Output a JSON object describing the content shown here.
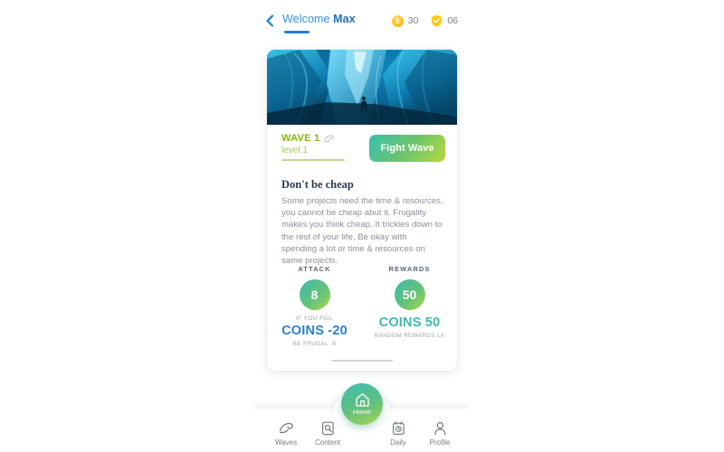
{
  "header": {
    "back_icon": "chevron-left-icon",
    "welcome_prefix": "Welcome ",
    "user_name": "Max",
    "coins": {
      "icon": "coin-icon",
      "value": "30"
    },
    "shields": {
      "icon": "shield-check-icon",
      "value": "06"
    }
  },
  "card": {
    "hero": {
      "alt": "ice-cave-photo"
    },
    "wave": {
      "title": "WAVE 1",
      "icon": "wave-icon",
      "level": "level 1",
      "fight_button": "Fight Wave"
    },
    "lesson": {
      "title": "Don't be cheap",
      "body": "Some projects need the time & resources, you cannot be cheap abut it. Frugality makes you think cheap. It trickles down to the rest of your life, Be okay with spending a lot or time & resources on same projects."
    },
    "stats": [
      {
        "head": "ATTACK",
        "circle_value": "8",
        "sub": "IF YOU FAIL",
        "main": "COINS -20",
        "foot": "BE FRUGAL -8"
      },
      {
        "head": "REWARDS",
        "circle_value": "50",
        "sub": "",
        "main": "COINS 50",
        "foot": "RANDOM REWARDS 1X"
      }
    ]
  },
  "nav": {
    "items": [
      {
        "label": "Waves",
        "icon": "wave-icon"
      },
      {
        "label": "Content",
        "icon": "document-search-icon"
      },
      {
        "label": "Daily",
        "icon": "calendar-clock-icon"
      },
      {
        "label": "Profile",
        "icon": "person-icon"
      }
    ],
    "home": {
      "label": "Home",
      "icon": "home-icon"
    }
  },
  "colors": {
    "accent_blue": "#1f7fd0",
    "wave_green": "#7fb800",
    "gradient_start": "#3dbcb0",
    "gradient_end": "#a9d64a",
    "coin_yellow": "#ffc222",
    "fail_blue": "#2a7fd4",
    "reward_teal": "#3cb8ad"
  }
}
